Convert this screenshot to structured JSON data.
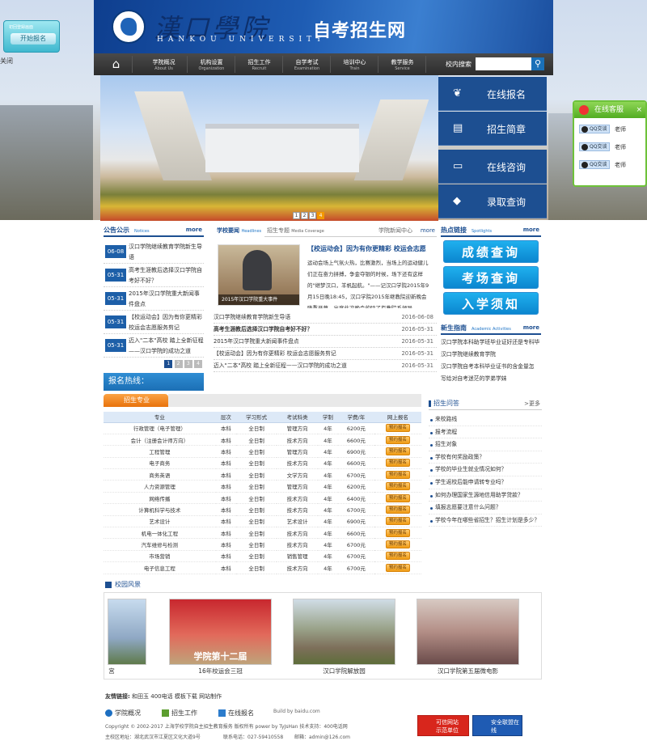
{
  "float_start": {
    "caption": "初回登録画面",
    "button": "开始报名",
    "close": "关闭"
  },
  "header": {
    "logo_cn": "漢口學院",
    "logo_en": "HANKOU UNIVERSITY",
    "site_title": "自考招生网"
  },
  "nav": {
    "home_icon": "home-icon",
    "items": [
      {
        "cn": "学院概况",
        "en": "About Us"
      },
      {
        "cn": "机构设置",
        "en": "Organization"
      },
      {
        "cn": "招生工作",
        "en": "Recruit"
      },
      {
        "cn": "自学考试",
        "en": "Examination"
      },
      {
        "cn": "培训中心",
        "en": "Train"
      },
      {
        "cn": "教学服务",
        "en": "Service"
      }
    ],
    "search_label": "校内搜索",
    "search_placeholder": "",
    "search_icon": "search-icon"
  },
  "banner": {
    "pages": [
      "1",
      "2",
      "3",
      "4"
    ],
    "active": "4"
  },
  "quick": [
    {
      "label": "在线报名",
      "icon": "sprout-icon"
    },
    {
      "label": "招生简章",
      "icon": "book-icon"
    },
    {
      "label": "在线咨询",
      "icon": "screen-icon"
    },
    {
      "label": "录取查询",
      "icon": "mortarboard-icon"
    }
  ],
  "kefu": {
    "title": "在线客服",
    "close": "×",
    "rows": [
      {
        "badge": "QQ交谈",
        "name": "老师"
      },
      {
        "badge": "QQ交谈",
        "name": "老师"
      },
      {
        "badge": "QQ交谈",
        "name": "老师"
      }
    ]
  },
  "notice": {
    "title": "公告公示",
    "en": "Notices",
    "more": "more",
    "items": [
      {
        "date": "06-08",
        "text": "汉口学院继续教育学院新生导语"
      },
      {
        "date": "05-31",
        "text": "高考生涯教后选择汉口学院自考好不好？"
      },
      {
        "date": "05-31",
        "text": "2015年汉口学院重大新闻事件盘点"
      },
      {
        "date": "05-31",
        "text": "【校运动会】因为有你更精彩 校运会志愿服务剪记"
      },
      {
        "date": "05-31",
        "text": "迈入\"二本\"高校 踏上全新征程——汉口学院的成功之道"
      }
    ],
    "pages": [
      "1",
      "2",
      "3",
      "4"
    ],
    "hotline": "报名热线："
  },
  "news": {
    "tab_a": "学校要闻",
    "tab_a_en": "Headlines",
    "tab_b": "招生专题",
    "tab_b_en": "Media Coverage",
    "center": "学院新闻中心",
    "more": "more",
    "photo_caption": "2015年汉口学院重大事件",
    "headline": "【校运动会】因为有你更精彩 校运会志愿",
    "body": "运动会场上气氛火热，比赛激烈，当场上的运动健儿们正在奋力拼搏，争金夺银的时候，场下还有这样的\"继梦汉口，羊帆起航。\"——记汉口学院2015年9月15日晚18:45，汉口学院2015年继教院迎新晚会隆重开幕，出席此次晚会的除了有教院系领导",
    "body_hl": "\"继梦汉口，羊帆起航。\"——记汉口学院2",
    "list": [
      {
        "title": "汉口学院继续教育学院新生导语",
        "date": "2016-06-08"
      },
      {
        "title": "高考生涯教后选择汉口学院自考好不好？",
        "date": "2016-05-31"
      },
      {
        "title": "2015年汉口学院重大新闻事件盘点",
        "date": "2016-05-31"
      },
      {
        "title": "【校运动会】因为有你更精彩 校运会志愿服务剪记",
        "date": "2016-05-31"
      },
      {
        "title": "迈入\"二本\"高校 踏上全新征程——汉口学院的成功之道",
        "date": "2016-05-31"
      }
    ]
  },
  "spot": {
    "title": "热点链接",
    "en": "Spotlights",
    "more": "more",
    "buttons": [
      "成绩查询",
      "考场查询",
      "入学须知"
    ],
    "guide_title": "新生指南",
    "guide_en": "Academic Activities",
    "guide_more": "more",
    "guide": [
      "汉口学院本科助学班毕业证好还是专科毕",
      "汉口学院继续教育学院",
      "汉口学院自考本科毕业证书的含金量怎",
      "写给对自考迷茫的学弟学妹"
    ]
  },
  "majors": {
    "tab": "招生专业",
    "headers": [
      "专业",
      "层次",
      "学习形式",
      "考试科类",
      "学制",
      "学费/年",
      "网上报名"
    ],
    "apply_label": "预约报名",
    "rows": [
      [
        "行政管理（电子管理）",
        "本科",
        "全日制",
        "管理方向",
        "4年",
        "6200元"
      ],
      [
        "会计（注册会计师方向）",
        "本科",
        "全日制",
        "技术方向",
        "4年",
        "6600元"
      ],
      [
        "工程管理",
        "本科",
        "全日制",
        "管理方向",
        "4年",
        "6900元"
      ],
      [
        "电子商务",
        "本科",
        "全日制",
        "技术方向",
        "4年",
        "6600元"
      ],
      [
        "商务英语",
        "本科",
        "全日制",
        "文学方向",
        "4年",
        "6700元"
      ],
      [
        "人力资源管理",
        "本科",
        "全日制",
        "管理方向",
        "4年",
        "6200元"
      ],
      [
        "网络传播",
        "本科",
        "全日制",
        "技术方向",
        "4年",
        "6400元"
      ],
      [
        "计算机科学与技术",
        "本科",
        "全日制",
        "技术方向",
        "4年",
        "6700元"
      ],
      [
        "艺术设计",
        "本科",
        "全日制",
        "艺术设计",
        "4年",
        "6900元"
      ],
      [
        "机电一体化工程",
        "本科",
        "全日制",
        "技术方向",
        "4年",
        "6600元"
      ],
      [
        "汽车维修与检测",
        "本科",
        "全日制",
        "技术方向",
        "4年",
        "6700元"
      ],
      [
        "市场营销",
        "本科",
        "全日制",
        "销售管理",
        "4年",
        "6700元"
      ],
      [
        "电子信息工程",
        "本科",
        "全日制",
        "技术方向",
        "4年",
        "6700元"
      ]
    ]
  },
  "faq": {
    "title": "招生问答",
    "more": ">更多",
    "items": [
      "来校路线",
      "报考流程",
      "招生对象",
      "学校有何奖励政策？",
      "学校的毕业生就业情况如何？",
      "学生返校后能申请转专业吗？",
      "如何办理国家生源地信用助学贷款？",
      "填报志愿要注意什么问题？",
      "学校今年在哪些省招生？招生计划是多少？"
    ]
  },
  "campus": {
    "title": "校园风景",
    "photos": [
      {
        "caption": "宫"
      },
      {
        "caption": "16年校运会三冠"
      },
      {
        "caption": "汉口学院解放园"
      },
      {
        "caption": "汉口学院第五届微电影"
      }
    ],
    "banner_text": "学院第十二届"
  },
  "links": {
    "label": "友情链接:",
    "items": "和田玉 400电话 模板下载 网站制作"
  },
  "footer": {
    "l1": "学院概况",
    "l2": "招生工作",
    "l3": "在线报名",
    "build": "Build by baidu.com",
    "copyright": "Copyright © 2002-2017 上海学校学院自主招生教育报务 版权所有 power by TyJsHan 技术支持：400电话网",
    "address": "主校区地址：湖北武汉市江夏区文化大道9号",
    "phone": "联系电话：027-59410558",
    "email": "邮箱：admin@126.com",
    "badge1": "可信网站 示范单位",
    "badge2": "安全联盟在线"
  }
}
